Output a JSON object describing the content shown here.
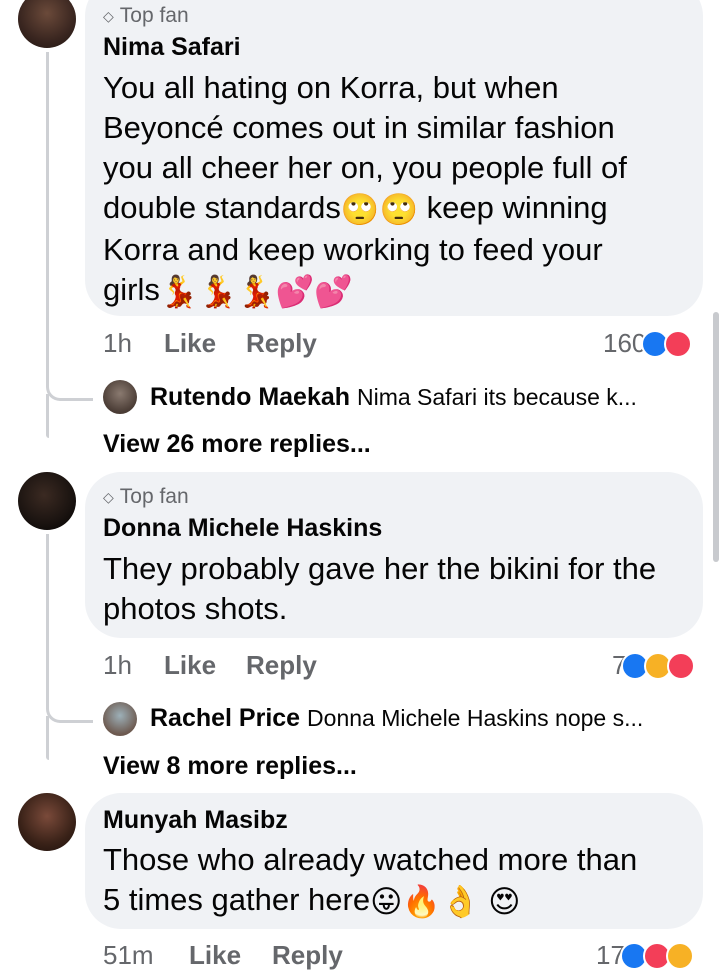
{
  "comments": [
    {
      "badge": "Top fan",
      "author": "Nima Safari",
      "lines": [
        "You all hating on Korra, but when",
        "Beyoncé comes out in similar fashion",
        "you all cheer her on, you people full of",
        "double standards",
        "keep winning",
        "Korra and keep working to feed your",
        "girls"
      ],
      "time": "1h",
      "like_label": "Like",
      "reply_label": "Reply",
      "reaction_count": "160",
      "reactions": [
        "like-icon",
        "love-icon"
      ],
      "reply_preview": {
        "author": "Rutendo Maekah",
        "text": "Nima Safari its because k..."
      },
      "view_more": "View 26 more replies..."
    },
    {
      "badge": "Top fan",
      "author": "Donna Michele Haskins",
      "lines": [
        "They probably gave her the bikini for the",
        "photos shots."
      ],
      "time": "1h",
      "like_label": "Like",
      "reply_label": "Reply",
      "reaction_count": "7",
      "reactions": [
        "like-icon",
        "haha-icon",
        "love-icon"
      ],
      "reply_preview": {
        "author": "Rachel Price",
        "text": "Donna Michele Haskins nope s..."
      },
      "view_more": "View 8 more replies..."
    },
    {
      "author": "Munyah Masibz",
      "lines": [
        "Those who already watched more than",
        "5 times gather here"
      ],
      "time": "51m",
      "like_label": "Like",
      "reply_label": "Reply",
      "reaction_count": "17",
      "reactions": [
        "like-icon",
        "love-icon",
        "haha-icon"
      ]
    }
  ],
  "colors": {
    "like": "#1877f2",
    "love": "#f33e58",
    "haha": "#f7b125",
    "bubble": "#f0f2f5",
    "meta": "#65676b"
  }
}
